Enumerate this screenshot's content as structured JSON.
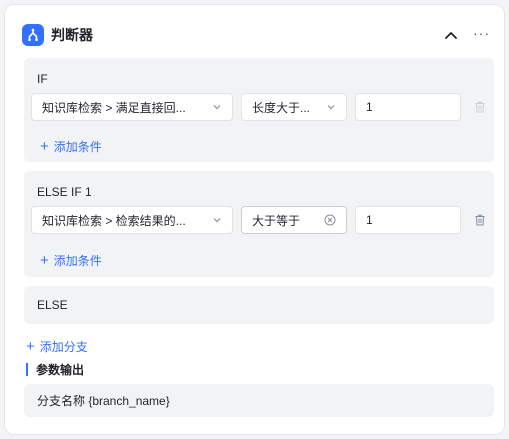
{
  "node": {
    "title": "判断器",
    "icon": "branch-node-icon",
    "accent": "#3370ff"
  },
  "header": {
    "collapse_icon": "chevron-up-icon",
    "more_icon": "more-icon"
  },
  "branches": [
    {
      "title": "IF",
      "condition": {
        "variable": "知识库检索 > 满足直接回...",
        "operator": "长度大于...",
        "value": "1"
      },
      "add_condition_label": "添加条件"
    },
    {
      "title": "ELSE IF 1",
      "condition": {
        "variable": "知识库检索 > 检索结果的...",
        "operator": "大于等于",
        "value": "1"
      },
      "add_condition_label": "添加条件"
    }
  ],
  "else_branch": {
    "title": "ELSE"
  },
  "add_branch_label": "添加分支",
  "output": {
    "section_title": "参数输出",
    "items": [
      {
        "label": "分支名称 {branch_name}"
      }
    ]
  }
}
